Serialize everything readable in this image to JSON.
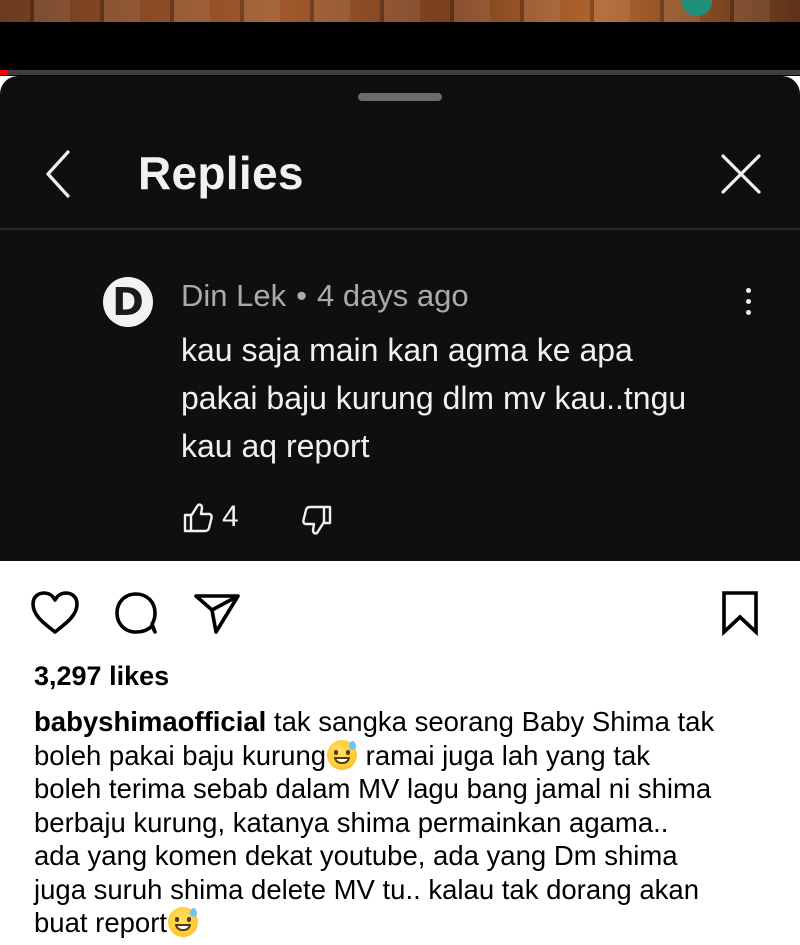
{
  "video": {
    "progress": 0.01
  },
  "replies_panel": {
    "title": "Replies",
    "comment": {
      "avatar_letter": "D",
      "author": "Din Lek",
      "separator": "•",
      "time": "4 days ago",
      "lines": [
        "kau saja main kan agma ke apa",
        "pakai baju kurung dlm mv kau..tngu",
        "kau aq report"
      ],
      "like_count": "4"
    }
  },
  "post": {
    "likes": "3,297 likes",
    "username": "babyshimaofficial",
    "caption_lines": [
      " tak sangka seorang Baby Shima tak",
      "boleh pakai baju kurung",
      " ramai juga lah yang tak",
      "boleh terima sebab dalam MV lagu bang jamal ni shima",
      "berbaju kurung, katanya shima permainkan agama..",
      "ada yang komen dekat youtube, ada yang Dm shima",
      "juga suruh shima delete MV tu.. kalau tak dorang akan",
      "buat report"
    ],
    "emoji_name": "grinning-face-with-sweat"
  },
  "colors": {
    "panel_bg": "#0f0f0f",
    "text_light": "#f1f1f1",
    "text_muted": "#aaaaaa",
    "progress_red": "#ff0000",
    "ig_text": "#000000"
  },
  "icons": [
    "back-icon",
    "close-icon",
    "more-icon",
    "thumbs-up-icon",
    "thumbs-down-icon",
    "heart-icon",
    "comment-icon",
    "share-icon",
    "bookmark-icon"
  ]
}
